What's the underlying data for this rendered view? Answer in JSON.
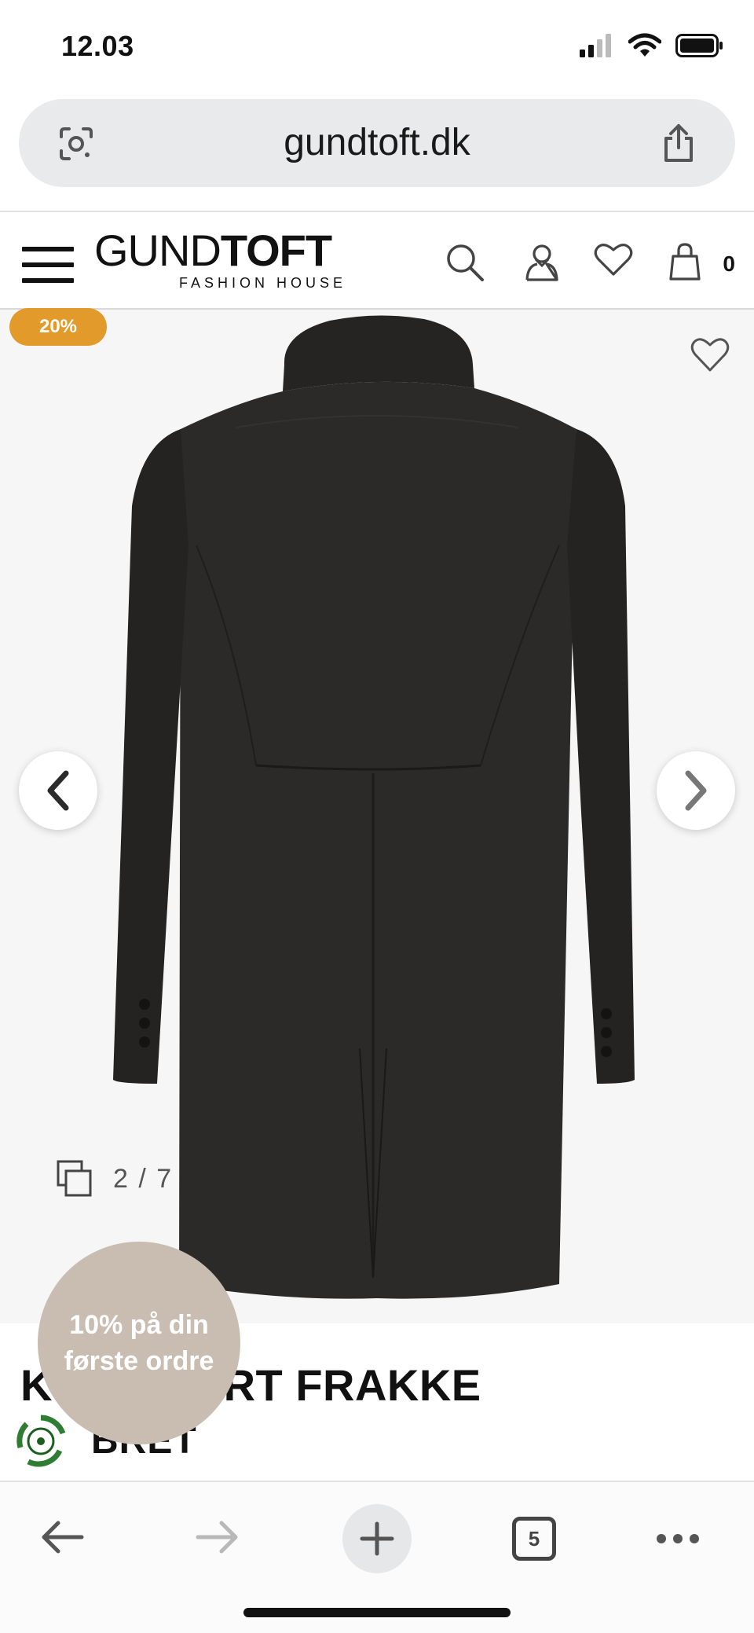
{
  "status": {
    "time": "12.03"
  },
  "browser": {
    "url": "gundtoft.dk",
    "tab_count": "5"
  },
  "header": {
    "logo_light": "GUND",
    "logo_bold": "TOFT",
    "logo_sub": "FASHION HOUSE",
    "cart_count": "0"
  },
  "product": {
    "discount": "20%",
    "image_counter": "2 / 7",
    "title": "KORT SORT FRAKKE",
    "brand": "BRET"
  },
  "promo": {
    "line1": "10% på din",
    "line2": "første ordre"
  },
  "icons": {
    "url_lens": "google-lens-icon",
    "share": "share-icon",
    "menu": "hamburger-icon",
    "search": "search-icon",
    "account": "user-icon",
    "wishlist": "heart-icon",
    "cart": "bag-icon",
    "prev": "chevron-left-icon",
    "next": "chevron-right-icon",
    "gallery": "gallery-icon",
    "eco": "recycle-icon",
    "back": "arrow-left-icon",
    "forward": "arrow-right-icon",
    "new_tab": "plus-icon",
    "more": "more-icon"
  },
  "colors": {
    "badge": "#e29b2a",
    "promo": "#c9bdb1",
    "coat": "#2a2826",
    "eco_green": "#2e7d32"
  }
}
